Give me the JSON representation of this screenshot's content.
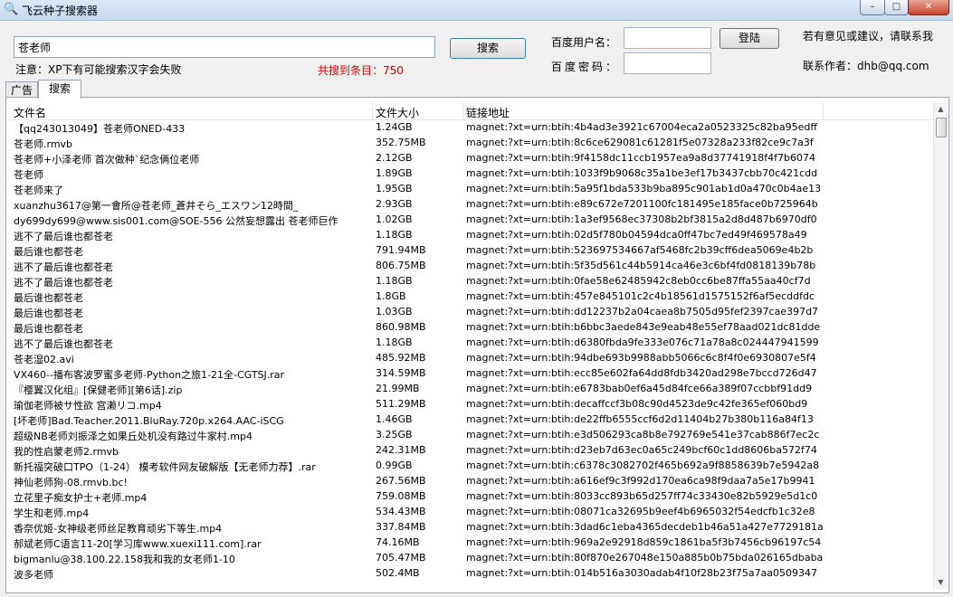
{
  "window": {
    "title": "飞云种子搜索器",
    "minimize": "–",
    "maximize": "□",
    "close": "✕",
    "icon": "magnifier-icon"
  },
  "search": {
    "query": "苍老师",
    "button_label": "搜索",
    "note": "注意：XP下有可能搜索汉字会失败",
    "found_text": "共搜到条目：750"
  },
  "login": {
    "user_label": "百度用户名：",
    "pwd_label": "百度密码：",
    "button_label": "登陆"
  },
  "contact": {
    "suggest": "若有意见或建议，请联系我",
    "author": "联系作者：dhb@qq.com"
  },
  "tabs": [
    {
      "label": "广告"
    },
    {
      "label": "搜索"
    }
  ],
  "table": {
    "headers": {
      "name": "文件名",
      "size": "文件大小",
      "link": "链接地址"
    },
    "rows": [
      {
        "name": "【qq243013049】苍老师ONED-433",
        "size": "1.24GB",
        "link": "magnet:?xt=urn:btih:4b4ad3e3921c67004eca2a0523325c82ba95edff"
      },
      {
        "name": "苍老师.rmvb",
        "size": "352.75MB",
        "link": "magnet:?xt=urn:btih:8c6ce629081c61281f5e07328a233f82ce9c7a3f"
      },
      {
        "name": "苍老师+小泽老师 首次做种`纪念俩位老师",
        "size": "2.12GB",
        "link": "magnet:?xt=urn:btih:9f4158dc11ccb1957ea9a8d37741918f4f7b6074"
      },
      {
        "name": "苍老师",
        "size": "1.89GB",
        "link": "magnet:?xt=urn:btih:1033f9b9068c35a1be3ef17b3437cbb70c421cdd"
      },
      {
        "name": "苍老师来了",
        "size": "1.95GB",
        "link": "magnet:?xt=urn:btih:5a95f1bda533b9ba895c901ab1d0a470c0b4ae13"
      },
      {
        "name": "xuanzhu3617@第一會所@苍老师_蒼井そら_エスワン12時間_",
        "size": "2.93GB",
        "link": "magnet:?xt=urn:btih:e89c672e7201100fc181495e185face0b725964b"
      },
      {
        "name": "dy699dy699@www.sis001.com@SOE-556 公然妄想露出 苍老师巨作",
        "size": "1.02GB",
        "link": "magnet:?xt=urn:btih:1a3ef9568ec37308b2bf3815a2d8d487b6970df0"
      },
      {
        "name": "逃不了最后谁也都苍老",
        "size": "1.18GB",
        "link": "magnet:?xt=urn:btih:02d5f780b04594dca0ff47bc7ed49f469578a49"
      },
      {
        "name": "最后谁也都苍老",
        "size": "791.94MB",
        "link": "magnet:?xt=urn:btih:523697534667af5468fc2b39cff6dea5069e4b2b"
      },
      {
        "name": "逃不了最后谁也都苍老",
        "size": "806.75MB",
        "link": "magnet:?xt=urn:btih:5f35d561c44b5914ca46e3c6bf4fd0818139b78b"
      },
      {
        "name": "逃不了最后谁也都苍老",
        "size": "1.18GB",
        "link": "magnet:?xt=urn:btih:0fae58e62485942c8eb0cc6be87ffa55aa40cf7d"
      },
      {
        "name": "最后谁也都苍老",
        "size": "1.8GB",
        "link": "magnet:?xt=urn:btih:457e845101c2c4b18561d1575152f6af5ecddfdc"
      },
      {
        "name": "最后谁也都苍老",
        "size": "1.03GB",
        "link": "magnet:?xt=urn:btih:dd12237b2a04caea8b7505d95fef2397cae397d7"
      },
      {
        "name": "最后谁也都苍老",
        "size": "860.98MB",
        "link": "magnet:?xt=urn:btih:b6bbc3aede843e9eab48e55ef78aad021dc81dde"
      },
      {
        "name": "逃不了最后谁也都苍老",
        "size": "1.18GB",
        "link": "magnet:?xt=urn:btih:d6380fbda9fe333e076c71a78a8c024447941599"
      },
      {
        "name": "苍老湿02.avi",
        "size": "485.92MB",
        "link": "magnet:?xt=urn:btih:94dbe693b9988abb5066c6c8f4f0e6930807e5f4"
      },
      {
        "name": "VX460--播布客波罗蜜多老师-Python之旅1-21全-CGTSJ.rar",
        "size": "314.59MB",
        "link": "magnet:?xt=urn:btih:ecc85e602fa64dd8fdb3420ad298e7bccd726d47"
      },
      {
        "name": "『樱翼汉化组』[保健老师][第6话].zip",
        "size": "21.99MB",
        "link": "magnet:?xt=urn:btih:e6783bab0ef6a45d84fce66a389f07ccbbf91dd9"
      },
      {
        "name": "瑜伽老师被サ性欲 宫濑リコ.mp4",
        "size": "511.29MB",
        "link": "magnet:?xt=urn:btih:decaffccf3b08c90d4523de9c42fe365ef060bd9"
      },
      {
        "name": "[坏老师]Bad.Teacher.2011.BluRay.720p.x264.AAC-iSCG",
        "size": "1.46GB",
        "link": "magnet:?xt=urn:btih:de22ffb6555ccf6d2d11404b27b380b116a84f13"
      },
      {
        "name": "超级NB老师刘振泽之如果丘处机没有路过牛家村.mp4",
        "size": "3.25GB",
        "link": "magnet:?xt=urn:btih:e3d506293ca8b8e792769e541e37cab886f7ec2c"
      },
      {
        "name": "我的性启蒙老师2.rmvb",
        "size": "242.31MB",
        "link": "magnet:?xt=urn:btih:d23eb7d63ec0a65c249bcf60c1dd8606ba572f74"
      },
      {
        "name": "新托福突破口TPO（1-24） 模考软件网友破解版【无老师力荐】.rar",
        "size": "0.99GB",
        "link": "magnet:?xt=urn:btih:c6378c3082702f465b692a9f8858639b7e5942a8"
      },
      {
        "name": "神仙老师狗-08.rmvb.bc!",
        "size": "267.56MB",
        "link": "magnet:?xt=urn:btih:a616ef9c3f992d170ea6ca98f9daa7a5e17b9941"
      },
      {
        "name": "立花里子痴女护士+老师.mp4",
        "size": "759.08MB",
        "link": "magnet:?xt=urn:btih:8033cc893b65d257ff74c33430e82b5929e5d1c0"
      },
      {
        "name": "学生和老师.mp4",
        "size": "534.43MB",
        "link": "magnet:?xt=urn:btih:08071ca32695b9eef4b6965032f54edcfb1c32e8"
      },
      {
        "name": "香奈优姬-女神级老师丝足教育顽劣下等生.mp4",
        "size": "337.84MB",
        "link": "magnet:?xt=urn:btih:3dad6c1eba4365decdeb1b46a51a427e7729181a"
      },
      {
        "name": "郝斌老师C语言11-20[学习库www.xuexi111.com].rar",
        "size": "74.16MB",
        "link": "magnet:?xt=urn:btih:969a2e92918d859c1861ba5f3b7456cb96197c54"
      },
      {
        "name": "bigmanlu@38.100.22.158我和我的女老师1-10",
        "size": "705.47MB",
        "link": "magnet:?xt=urn:btih:80f870e267048e150a885b0b75bda026165dbaba"
      },
      {
        "name": "波多老师",
        "size": "502.4MB",
        "link": "magnet:?xt=urn:btih:014b516a3030adab4f10f28b23f75a7aa0509347"
      }
    ]
  },
  "scrollbar": {
    "up": "▲",
    "down": "▼"
  }
}
